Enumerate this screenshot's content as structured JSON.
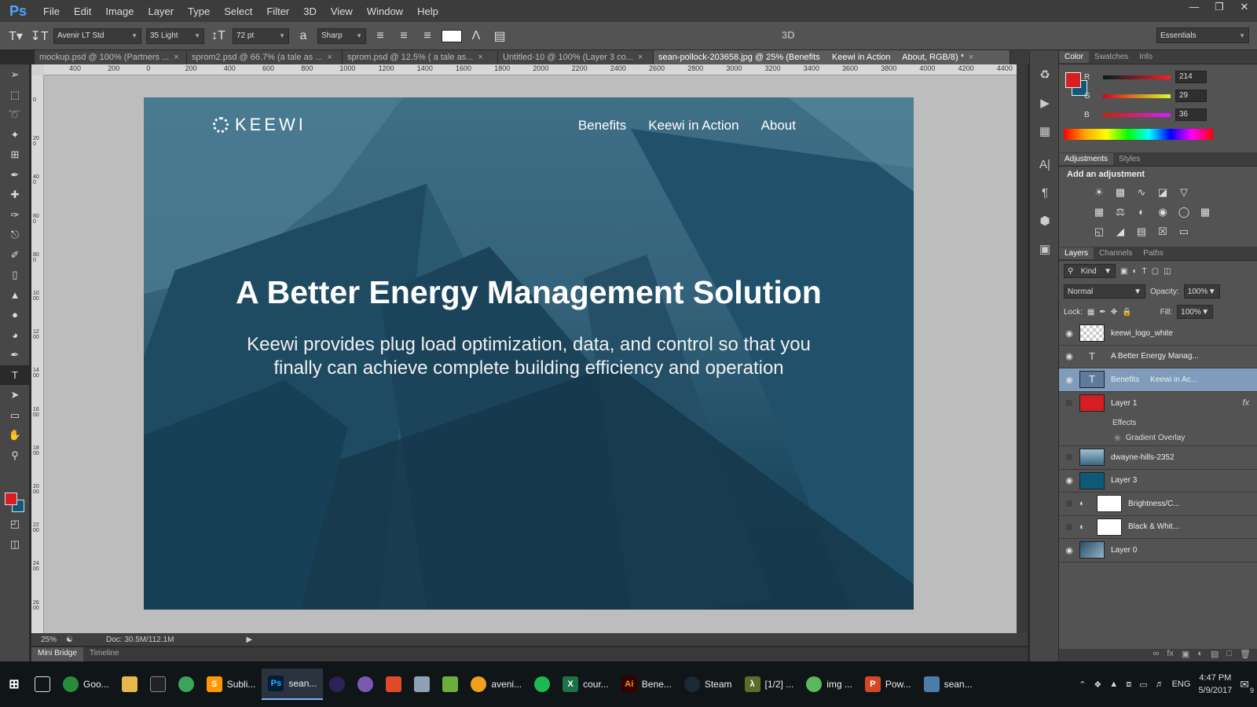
{
  "app": {
    "logo": "Ps",
    "menu": [
      "File",
      "Edit",
      "Image",
      "Layer",
      "Type",
      "Select",
      "Filter",
      "3D",
      "View",
      "Window",
      "Help"
    ]
  },
  "options": {
    "font_family": "Avenir LT Std",
    "font_style": "35 Light",
    "font_size": "72 pt",
    "anti_alias": "Sharp",
    "threed_label": "3D",
    "workspace": "Essentials"
  },
  "tabs": [
    {
      "label": "mockup.psd @ 100% (Partners ...",
      "close": "×"
    },
    {
      "label": "sprom2.psd @ 66.7% (a tale as ...",
      "close": "×"
    },
    {
      "label": "sprom.psd @ 12.5% ( a tale  as...",
      "close": "×"
    },
    {
      "label": "Untitled-10 @ 100% (Layer 3 co...",
      "close": "×"
    },
    {
      "label": "sean-pollock-203658.jpg @ 25% (Benefits     Keewi in Action     About, RGB/8) *",
      "close": "×"
    }
  ],
  "ruler_top": [
    "400",
    "200",
    "0",
    "200",
    "400",
    "600",
    "800",
    "1000",
    "1200",
    "1400",
    "1600",
    "1800",
    "2000",
    "2200",
    "2400",
    "2600",
    "2800",
    "3000",
    "3200",
    "3400",
    "3600",
    "3800",
    "4000",
    "4200",
    "4400"
  ],
  "ruler_left": [
    "0",
    "2 0 0",
    "4 0 0",
    "6 0 0",
    "8 0 0",
    "1 0 0 0",
    "1 2 0 0",
    "1 4 0 0",
    "1 6 0 0",
    "1 8 0 0",
    "2 0 0 0",
    "2 2 0 0",
    "2 4 0 0",
    "2 6 0 0"
  ],
  "artboard": {
    "logo_text": "KEEWI",
    "nav": [
      "Benefits",
      "Keewi in Action",
      "About"
    ],
    "title": "A Better Energy Management Solution",
    "subtitle_line1": "Keewi provides plug load optimization, data, and control so that you",
    "subtitle_line2": "finally can achieve complete building efficiency and operation"
  },
  "status": {
    "zoom": "25%",
    "doc": "Doc: 30.5M/112.1M"
  },
  "bottom_tabs": [
    "Mini Bridge",
    "Timeline"
  ],
  "color_panel": {
    "tabs": [
      "Color",
      "Swatches",
      "Info"
    ],
    "r_label": "R",
    "r": "214",
    "g_label": "G",
    "g": "29",
    "b_label": "B",
    "b": "36",
    "fg_color": "#d61d24",
    "bg_color": "#0e5a78"
  },
  "adjustments": {
    "tabs": [
      "Adjustments",
      "Styles"
    ],
    "title": "Add an adjustment"
  },
  "layers_panel": {
    "tabs": [
      "Layers",
      "Channels",
      "Paths"
    ],
    "kind": "Kind",
    "blend": "Normal",
    "opacity_label": "Opacity:",
    "opacity": "100%",
    "lock_label": "Lock:",
    "fill_label": "Fill:",
    "fill": "100%",
    "layers": [
      {
        "name": "keewi_logo_white",
        "visible": true
      },
      {
        "name": "A Better Energy Manag...",
        "visible": true
      },
      {
        "name": "Benefits     Keewi in Ac...",
        "visible": true
      },
      {
        "name": "Layer 1",
        "visible": false
      },
      {
        "name": "dwayne-hills-2352",
        "visible": false
      },
      {
        "name": "Layer 3",
        "visible": true
      },
      {
        "name": "Brightness/C...",
        "visible": false
      },
      {
        "name": "Black & Whit...",
        "visible": false
      },
      {
        "name": "Layer 0",
        "visible": true
      }
    ],
    "effects_label": "Effects",
    "effect_item": "Gradient Overlay",
    "fx": "fx"
  },
  "taskbar": {
    "items": [
      "Goo...",
      "",
      "",
      "",
      "Subli...",
      "sean...",
      "",
      "",
      "",
      "",
      "",
      "aveni...",
      "",
      "cour...",
      "Bene...",
      "Steam",
      "[1/2] ...",
      "img ...",
      "Pow...",
      "sean..."
    ],
    "lang": "ENG",
    "time": "4:47 PM",
    "date": "5/9/2017",
    "notif": "9"
  }
}
